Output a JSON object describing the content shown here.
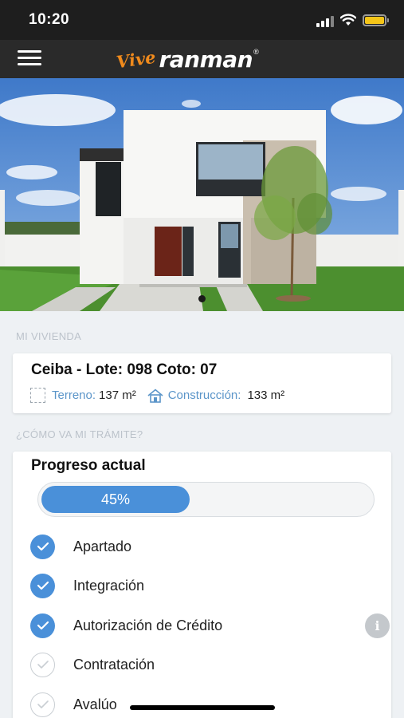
{
  "status_bar": {
    "time": "10:20"
  },
  "header": {
    "logo_script": "Vive",
    "logo_brand": "ranman",
    "logo_mark": "®",
    "menu_icon": "hamburger-menu-icon"
  },
  "hero": {
    "carousel_active": 1
  },
  "sections": {
    "my_home": "MI VIVIENDA",
    "my_process": "¿CÓMO VA MI TRÁMITE?"
  },
  "house": {
    "title": "Ceiba - Lote: 098 Coto: 07",
    "terrain_label": "Terreno:",
    "terrain_value": "137 m²",
    "construction_label": "Construcción:",
    "construction_value": "133 m²",
    "terrain_icon": "dashed-square-icon",
    "construction_icon": "house-icon"
  },
  "progress": {
    "title": "Progreso actual",
    "percent_label": "45%",
    "percent": 45,
    "accent_color": "#4a90d9",
    "steps": [
      {
        "label": "Apartado",
        "done": true
      },
      {
        "label": "Integración",
        "done": true
      },
      {
        "label": "Autorización de Crédito",
        "done": true,
        "info": "i"
      },
      {
        "label": "Contratación",
        "done": false
      },
      {
        "label": "Avalúo",
        "done": false
      }
    ]
  }
}
